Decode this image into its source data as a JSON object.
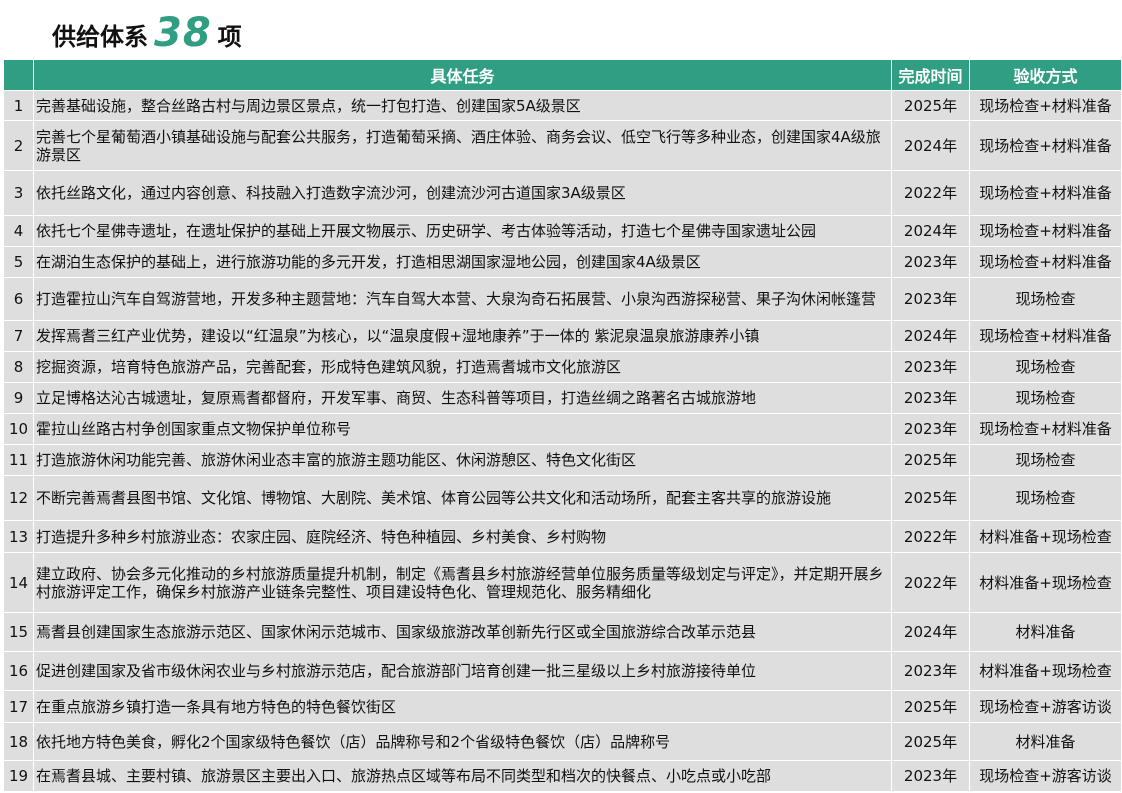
{
  "title": {
    "prefix": "供给体系",
    "number": "38",
    "suffix": "项"
  },
  "colors": {
    "header_green": "#2f9e82",
    "row_gray": "#dedede"
  },
  "table": {
    "headers": {
      "number": "",
      "task": "具体任务",
      "time": "完成时间",
      "method": "验收方式"
    },
    "rows": [
      {
        "num": "1",
        "task": "完善基础设施，整合丝路古村与周边景区景点，统一打包打造、创建国家5A级景区",
        "time": "2025年",
        "method": "现场检查+材料准备"
      },
      {
        "num": "2",
        "task": "完善七个星葡萄酒小镇基础设施与配套公共服务，打造葡萄采摘、酒庄体验、商务会议、低空飞行等多种业态，创建国家4A级旅游景区",
        "time": "2024年",
        "method": "现场检查+材料准备"
      },
      {
        "num": "3",
        "task": "依托丝路文化，通过内容创意、科技融入打造数字流沙河，创建流沙河古道国家3A级景区",
        "time": "2022年",
        "method": "现场检查+材料准备"
      },
      {
        "num": "4",
        "task": "依托七个星佛寺遗址，在遗址保护的基础上开展文物展示、历史研学、考古体验等活动，打造七个星佛寺国家遗址公园",
        "time": "2024年",
        "method": "现场检查+材料准备"
      },
      {
        "num": "5",
        "task": "在湖泊生态保护的基础上，进行旅游功能的多元开发，打造相思湖国家湿地公园，创建国家4A级景区",
        "time": "2023年",
        "method": "现场检查+材料准备"
      },
      {
        "num": "6",
        "task": "打造霍拉山汽车自驾游营地，开发多种主题营地：汽车自驾大本营、大泉沟奇石拓展营、小泉沟西游探秘营、果子沟休闲帐篷营",
        "time": "2023年",
        "method": "现场检查"
      },
      {
        "num": "7",
        "task": "发挥焉耆三红产业优势，建设以“红温泉”为核心，以“温泉度假+湿地康养”于一体的 紫泥泉温泉旅游康养小镇",
        "time": "2024年",
        "method": "现场检查+材料准备"
      },
      {
        "num": "8",
        "task": "挖掘资源，培育特色旅游产品，完善配套，形成特色建筑风貌，打造焉耆城市文化旅游区",
        "time": "2023年",
        "method": "现场检查"
      },
      {
        "num": "9",
        "task": "立足博格达沁古城遗址，复原焉耆都督府，开发军事、商贸、生态科普等项目，打造丝绸之路著名古城旅游地",
        "time": "2023年",
        "method": "现场检查"
      },
      {
        "num": "10",
        "task": "霍拉山丝路古村争创国家重点文物保护单位称号",
        "time": "2023年",
        "method": "现场检查+材料准备"
      },
      {
        "num": "11",
        "task": "打造旅游休闲功能完善、旅游休闲业态丰富的旅游主题功能区、休闲游憩区、特色文化街区",
        "time": "2025年",
        "method": "现场检查"
      },
      {
        "num": "12",
        "task": "不断完善焉耆县图书馆、文化馆、博物馆、大剧院、美术馆、体育公园等公共文化和活动场所，配套主客共享的旅游设施",
        "time": "2025年",
        "method": "现场检查"
      },
      {
        "num": "13",
        "task": "打造提升多种乡村旅游业态：农家庄园、庭院经济、特色种植园、乡村美食、乡村购物",
        "time": "2022年",
        "method": "材料准备+现场检查"
      },
      {
        "num": "14",
        "task": "建立政府、协会多元化推动的乡村旅游质量提升机制，制定《焉耆县乡村旅游经营单位服务质量等级划定与评定》，并定期开展乡村旅游评定工作，确保乡村旅游产业链条完整性、项目建设特色化、管理规范化、服务精细化",
        "time": "2022年",
        "method": "材料准备+现场检查"
      },
      {
        "num": "15",
        "task": "焉耆县创建国家生态旅游示范区、国家休闲示范城市、国家级旅游改革创新先行区或全国旅游综合改革示范县",
        "time": "2024年",
        "method": "材料准备"
      },
      {
        "num": "16",
        "task": "促进创建国家及省市级休闲农业与乡村旅游示范店，配合旅游部门培育创建一批三星级以上乡村旅游接待单位",
        "time": "2023年",
        "method": "材料准备+现场检查"
      },
      {
        "num": "17",
        "task": "在重点旅游乡镇打造一条具有地方特色的特色餐饮街区",
        "time": "2025年",
        "method": "现场检查+游客访谈"
      },
      {
        "num": "18",
        "task": "依托地方特色美食，孵化2个国家级特色餐饮（店）品牌称号和2个省级特色餐饮（店）品牌称号",
        "time": "2025年",
        "method": "材料准备"
      },
      {
        "num": "19",
        "task": "在焉耆县城、主要村镇、旅游景区主要出入口、旅游热点区域等布局不同类型和档次的快餐点、小吃点或小吃部",
        "time": "2023年",
        "method": "现场检查+游客访谈"
      }
    ]
  }
}
